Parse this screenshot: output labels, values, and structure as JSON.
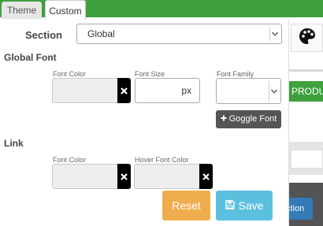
{
  "tabs": [
    {
      "label": "Theme"
    },
    {
      "label": "Custom"
    }
  ],
  "section": {
    "label": "Section",
    "selected": "Global"
  },
  "global_font": {
    "heading": "Global Font",
    "font_color_label": "Font Color",
    "font_size_label": "Font Size",
    "font_size_unit": "px",
    "font_family_label": "Font Family",
    "google_font_button": "Goggle Font"
  },
  "link": {
    "heading": "Link",
    "font_color_label": "Font Color",
    "hover_font_color_label": "Hover Font Color"
  },
  "buttons": {
    "reset": "Reset",
    "save": "Save"
  },
  "background": {
    "product_text": "PRODUC",
    "action_text": "ction"
  },
  "icons": {
    "palette": "palette-icon",
    "clear": "close-icon",
    "dropdown": "chevron-down-icon",
    "plus": "plus-icon",
    "save": "floppy-disk-icon"
  },
  "colors": {
    "green": "#3ea13e",
    "orange": "#f0ad4e",
    "cyan": "#5bc0de",
    "dark": "#555555"
  }
}
